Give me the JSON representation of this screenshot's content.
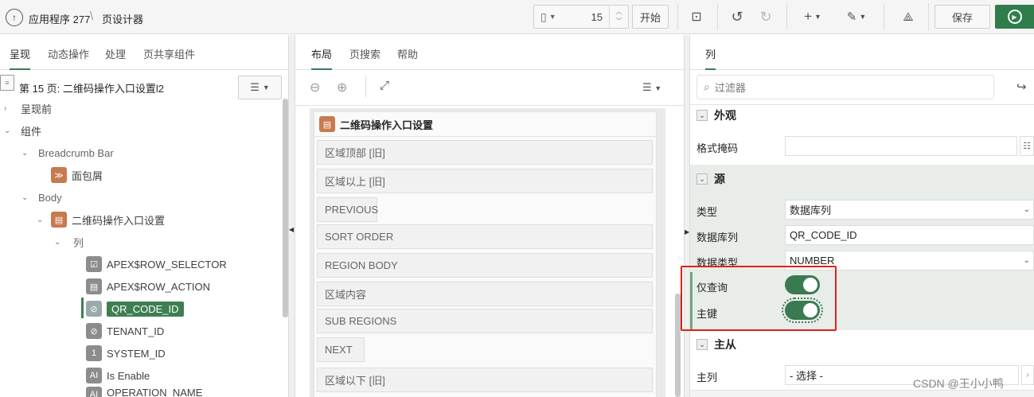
{
  "app": {
    "title": "应用程序 277",
    "page_designer": "页设计器"
  },
  "toolbar": {
    "page_number": "15",
    "start_label": "开始",
    "save_label": "保存"
  },
  "left": {
    "tabs": [
      "呈现",
      "动态操作",
      "处理",
      "页共享组件"
    ],
    "page_title": "第 15 页: 二维码操作入口设置l2",
    "tree": {
      "before_render": "呈现前",
      "components": "组件",
      "breadcrumb_bar": "Breadcrumb Bar",
      "breadcrumb": "面包屑",
      "body": "Body",
      "region": "二维码操作入口设置",
      "columns": "列",
      "col1": "APEX$ROW_SELECTOR",
      "col2": "APEX$ROW_ACTION",
      "col3": "QR_CODE_ID",
      "col4": "TENANT_ID",
      "col5": "SYSTEM_ID",
      "col6": "Is Enable",
      "col7": "OPERATION_NAME"
    }
  },
  "center": {
    "tabs": [
      "布局",
      "页搜索",
      "帮助"
    ],
    "region_title": "二维码操作入口设置",
    "slots": [
      "区域顶部 [旧]",
      "区域以上 [旧]",
      "PREVIOUS",
      "SORT ORDER",
      "REGION BODY",
      "区域内容",
      "SUB REGIONS",
      "NEXT",
      "区域以下 [旧]"
    ]
  },
  "right": {
    "tab": "列",
    "filter_placeholder": "过滤器",
    "appearance": "外观",
    "format_mask": "格式掩码",
    "source": "源",
    "type_label": "类型",
    "type_value": "数据库列",
    "db_column_label": "数据库列",
    "db_column_value": "QR_CODE_ID",
    "data_type_label": "数据类型",
    "data_type_value": "NUMBER",
    "query_only": "仅查询",
    "primary_key": "主键",
    "master_detail": "主从",
    "master_column": "主列",
    "master_column_value": "- 选择 -"
  },
  "watermark": "CSDN @王小小鸭",
  "colors": {
    "accent": "#3a7d55",
    "highlight": "#e0201a",
    "region_icon": "#c9794e"
  }
}
